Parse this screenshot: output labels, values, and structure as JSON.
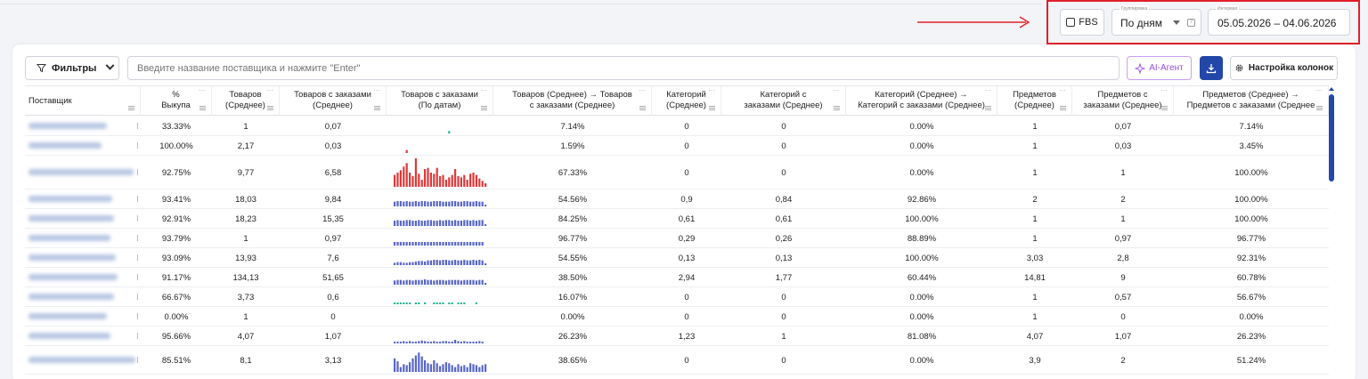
{
  "header": {
    "fbs_label": "FBS",
    "grouping_label": "Группировка",
    "grouping_value": "По дням",
    "interval_label": "Интервал",
    "interval_value": "05.05.2026 – 04.06.2026",
    "highlight_color": "#e0202a"
  },
  "toolbar": {
    "filters_label": "Фильтры",
    "search_placeholder": "Введите название поставщика и нажмите \"Enter\"",
    "ai_label": "AI-Агент",
    "columns_label": "Настройка колонок",
    "accent_color": "#2347a8"
  },
  "table": {
    "columns": [
      {
        "line1": "Поставщик",
        "line2": ""
      },
      {
        "line1": "%",
        "line2": "Выкупа"
      },
      {
        "line1": "Товаров",
        "line2": "(Среднее)"
      },
      {
        "line1": "Товаров с заказами",
        "line2": "(Среднее)"
      },
      {
        "line1": "Товаров с заказами",
        "line2": "(По датам)"
      },
      {
        "line1": "Товаров (Среднее) → Товаров",
        "line2": "с заказами (Среднее)"
      },
      {
        "line1": "Категорий",
        "line2": "(Среднее)"
      },
      {
        "line1": "Категорий с",
        "line2": "заказами (Среднее)"
      },
      {
        "line1": "Категорий (Среднее) →",
        "line2": "Категорий с заказами (Среднее)"
      },
      {
        "line1": "Предметов",
        "line2": "(Среднее)"
      },
      {
        "line1": "Предметов с",
        "line2": "заказами (Среднее)"
      },
      {
        "line1": "Предметов (Среднее) →",
        "line2": "Предметов с заказами (Среднее"
      }
    ],
    "rows": [
      {
        "pct": "33.33%",
        "items": "1",
        "items_orders": "0,07",
        "conv1": "7.14%",
        "cat": "0",
        "cat_orders": "0",
        "conv2": "0.00%",
        "subj": "1",
        "subj_orders": "0,07",
        "conv3": "7.14%",
        "spark_color": "#22b58f",
        "spark": [
          0,
          0,
          0,
          0,
          0,
          0,
          0,
          0,
          0,
          0,
          0,
          0,
          0,
          0,
          0,
          0,
          0,
          0,
          4,
          0,
          0,
          0,
          0,
          0,
          0,
          0,
          0,
          0,
          0,
          0,
          0
        ]
      },
      {
        "pct": "100.00%",
        "items": "2,17",
        "items_orders": "0,03",
        "conv1": "1.59%",
        "cat": "0",
        "cat_orders": "0",
        "conv2": "0.00%",
        "subj": "1",
        "subj_orders": "0,03",
        "conv3": "3.45%",
        "spark_color": "#e03838",
        "spark": [
          0,
          0,
          0,
          0,
          5,
          0,
          0,
          0,
          0,
          0,
          0,
          0,
          0,
          0,
          0,
          0,
          0,
          0,
          0,
          0,
          0,
          0,
          0,
          0,
          0,
          0,
          0,
          0,
          0,
          0,
          0
        ]
      },
      {
        "pct": "92.75%",
        "items": "9,77",
        "items_orders": "6,58",
        "conv1": "67.33%",
        "cat": "0",
        "cat_orders": "0",
        "conv2": "0.00%",
        "subj": "1",
        "subj_orders": "1",
        "conv3": "100.00%",
        "spark_color": "#e03838",
        "spark": [
          10,
          12,
          14,
          17,
          20,
          12,
          9,
          24,
          11,
          6,
          15,
          16,
          12,
          11,
          16,
          9,
          10,
          6,
          8,
          10,
          15,
          9,
          8,
          10,
          6,
          11,
          12,
          10,
          7,
          5,
          3
        ]
      },
      {
        "pct": "93.41%",
        "items": "18,03",
        "items_orders": "9,84",
        "conv1": "54.56%",
        "cat": "0,9",
        "cat_orders": "0,84",
        "conv2": "92.86%",
        "subj": "2",
        "subj_orders": "2",
        "conv3": "100.00%",
        "spark_color": "#5866c9",
        "spark": [
          8,
          9,
          9,
          8,
          9,
          8,
          8,
          9,
          8,
          9,
          9,
          8,
          8,
          9,
          9,
          9,
          8,
          8,
          8,
          9,
          9,
          8,
          8,
          9,
          9,
          8,
          8,
          9,
          8,
          8,
          2
        ]
      },
      {
        "pct": "92.91%",
        "items": "18,23",
        "items_orders": "15,35",
        "conv1": "84.25%",
        "cat": "0,61",
        "cat_orders": "0,61",
        "conv2": "100.00%",
        "subj": "1",
        "subj_orders": "1",
        "conv3": "100.00%",
        "spark_color": "#5866c9",
        "spark": [
          9,
          10,
          9,
          9,
          10,
          10,
          9,
          9,
          10,
          9,
          9,
          10,
          10,
          9,
          9,
          10,
          9,
          10,
          10,
          9,
          10,
          9,
          9,
          10,
          10,
          9,
          10,
          9,
          10,
          10,
          2
        ]
      },
      {
        "pct": "93.79%",
        "items": "1",
        "items_orders": "0,97",
        "conv1": "96.77%",
        "cat": "0,29",
        "cat_orders": "0,26",
        "conv2": "88.89%",
        "subj": "1",
        "subj_orders": "0,97",
        "conv3": "96.77%",
        "spark_color": "#5866c9",
        "spark": [
          6,
          6,
          6,
          6,
          6,
          6,
          6,
          6,
          6,
          6,
          6,
          6,
          6,
          6,
          6,
          6,
          6,
          6,
          6,
          6,
          6,
          6,
          6,
          6,
          6,
          6,
          6,
          6,
          6,
          6,
          0
        ]
      },
      {
        "pct": "93.09%",
        "items": "13,93",
        "items_orders": "7,6",
        "conv1": "54.55%",
        "cat": "0,13",
        "cat_orders": "0,13",
        "conv2": "100.00%",
        "subj": "3,03",
        "subj_orders": "2,8",
        "conv3": "92.31%",
        "spark_color": "#5866c9",
        "spark": [
          4,
          5,
          5,
          4,
          4,
          5,
          5,
          6,
          7,
          7,
          6,
          8,
          8,
          9,
          9,
          8,
          9,
          9,
          8,
          8,
          9,
          8,
          8,
          9,
          8,
          8,
          9,
          8,
          9,
          8,
          3
        ]
      },
      {
        "pct": "91.17%",
        "items": "134,13",
        "items_orders": "51,65",
        "conv1": "38.50%",
        "cat": "2,94",
        "cat_orders": "1,77",
        "conv2": "60.44%",
        "subj": "14,81",
        "subj_orders": "9",
        "conv3": "60.78%",
        "spark_color": "#5866c9",
        "spark": [
          7,
          8,
          8,
          7,
          8,
          8,
          7,
          8,
          8,
          8,
          9,
          8,
          8,
          7,
          8,
          8,
          8,
          7,
          8,
          8,
          8,
          8,
          7,
          8,
          8,
          8,
          8,
          7,
          8,
          8,
          2
        ]
      },
      {
        "pct": "66.67%",
        "items": "3,73",
        "items_orders": "0,6",
        "conv1": "16.07%",
        "cat": "0",
        "cat_orders": "0",
        "conv2": "0.00%",
        "subj": "1",
        "subj_orders": "0,57",
        "conv3": "56.67%",
        "spark_color": "#22b58f",
        "spark": [
          3,
          3,
          3,
          3,
          3,
          3,
          0,
          3,
          3,
          0,
          3,
          0,
          0,
          3,
          3,
          3,
          3,
          0,
          3,
          3,
          0,
          3,
          3,
          3,
          0,
          0,
          0,
          3,
          0,
          0,
          0
        ]
      },
      {
        "pct": "0.00%",
        "items": "1",
        "items_orders": "0",
        "conv1": "0.00%",
        "cat": "0",
        "cat_orders": "0",
        "conv2": "0.00%",
        "subj": "1",
        "subj_orders": "0",
        "conv3": "0.00%",
        "spark_color": "#5866c9",
        "spark": []
      },
      {
        "pct": "95.66%",
        "items": "4,07",
        "items_orders": "1,07",
        "conv1": "26.23%",
        "cat": "1,23",
        "cat_orders": "1",
        "conv2": "81.08%",
        "subj": "4,07",
        "subj_orders": "1,07",
        "conv3": "26.23%",
        "spark_color": "#5866c9",
        "spark": [
          3,
          3,
          3,
          4,
          3,
          4,
          3,
          3,
          4,
          5,
          4,
          3,
          3,
          4,
          3,
          3,
          4,
          4,
          3,
          3,
          6,
          4,
          3,
          4,
          3,
          3,
          3,
          3,
          4,
          3,
          0
        ]
      },
      {
        "pct": "85.51%",
        "items": "8,1",
        "items_orders": "3,13",
        "conv1": "38.65%",
        "cat": "0",
        "cat_orders": "0",
        "conv2": "0.00%",
        "subj": "3,9",
        "subj_orders": "2",
        "conv3": "51.24%",
        "spark_color": "#5866c9",
        "spark": [
          14,
          11,
          5,
          8,
          7,
          10,
          14,
          17,
          20,
          16,
          12,
          9,
          8,
          12,
          9,
          6,
          8,
          10,
          9,
          7,
          5,
          8,
          6,
          7,
          5,
          9,
          8,
          7,
          5,
          7,
          8
        ]
      }
    ]
  }
}
